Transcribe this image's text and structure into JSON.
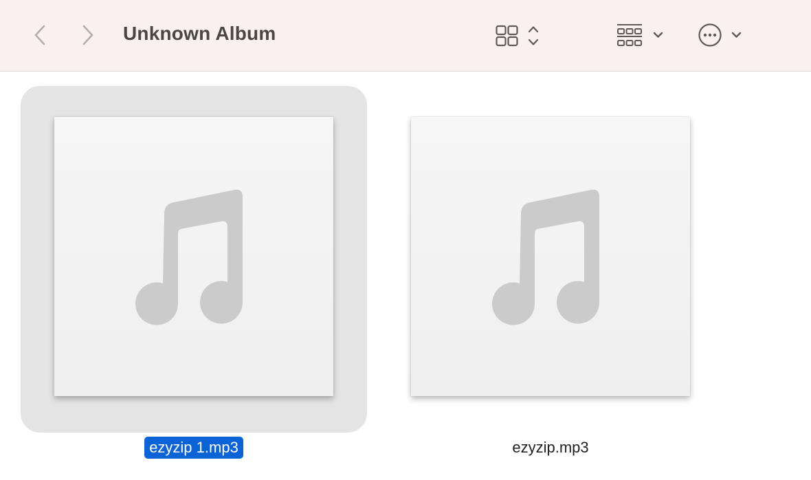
{
  "window": {
    "title": "Unknown Album"
  },
  "toolbar": {
    "back_icon": "chevron-left-icon",
    "forward_icon": "chevron-right-icon",
    "view_icon": "icon-grid-view-icon",
    "group_icon": "group-by-icon",
    "more_icon": "ellipsis-circle-icon"
  },
  "files": [
    {
      "name": "ezyzip 1.mp3",
      "selected": true,
      "icon": "music-note-icon"
    },
    {
      "name": "ezyzip.mp3",
      "selected": false,
      "icon": "music-note-icon"
    }
  ],
  "colors": {
    "toolbar_bg": "#f9f1f0",
    "selection_bg": "#0a64d8",
    "selected_tile_bg": "#e4e4e4",
    "note_gray": "#cbcbcb"
  }
}
